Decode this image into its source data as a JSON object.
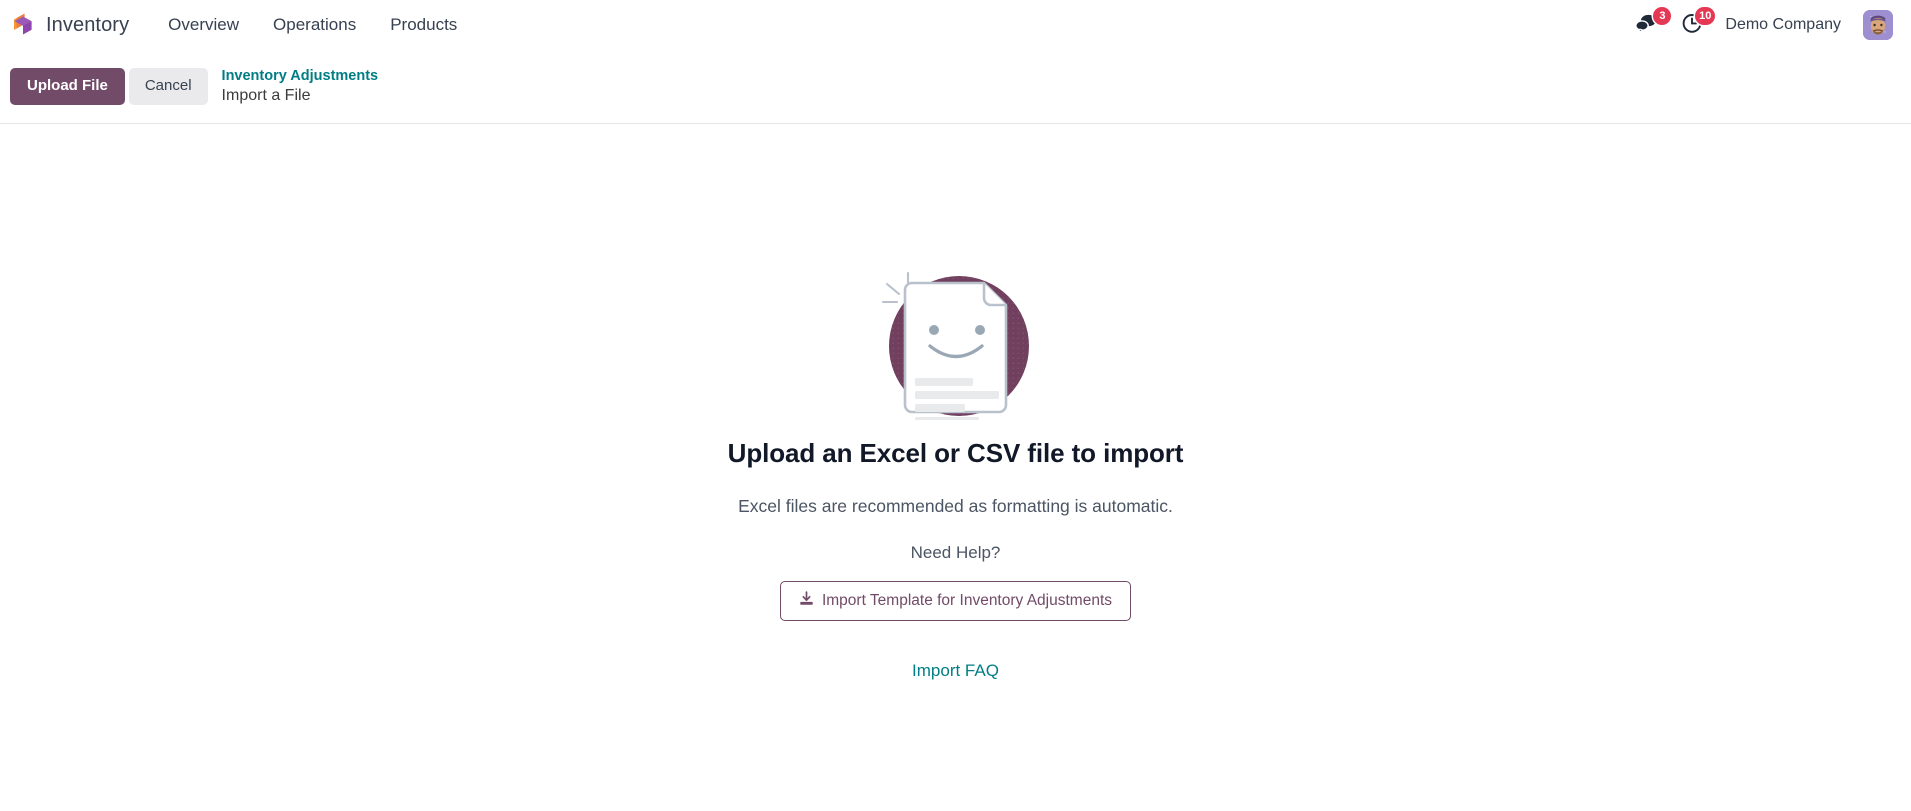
{
  "navbar": {
    "logo_icon": "cube-logo-icon",
    "app_name": "Inventory",
    "menu": [
      {
        "label": "Overview",
        "name": "nav-item-overview"
      },
      {
        "label": "Operations",
        "name": "nav-item-operations"
      },
      {
        "label": "Products",
        "name": "nav-item-products"
      }
    ],
    "messages": {
      "icon": "chat-bubbles-icon",
      "count": "3"
    },
    "activities": {
      "icon": "clock-icon",
      "count": "10"
    },
    "company": "Demo Company",
    "avatar_icon": "user-avatar"
  },
  "control_panel": {
    "upload_label": "Upload File",
    "cancel_label": "Cancel",
    "breadcrumb_parent": "Inventory Adjustments",
    "breadcrumb_current": "Import a File"
  },
  "main": {
    "illustration_icon": "smiling-document-illustration",
    "title": "Upload an Excel or CSV file to import",
    "subtitle": "Excel files are recommended as formatting is automatic.",
    "need_help": "Need Help?",
    "template_icon": "download-icon",
    "template_label": "Import Template for Inventory Adjustments",
    "faq_label": "Import FAQ"
  },
  "colors": {
    "primary": "#714b67",
    "link": "#017e84",
    "badge": "#e53855",
    "illustration_circle": "#70405e"
  }
}
